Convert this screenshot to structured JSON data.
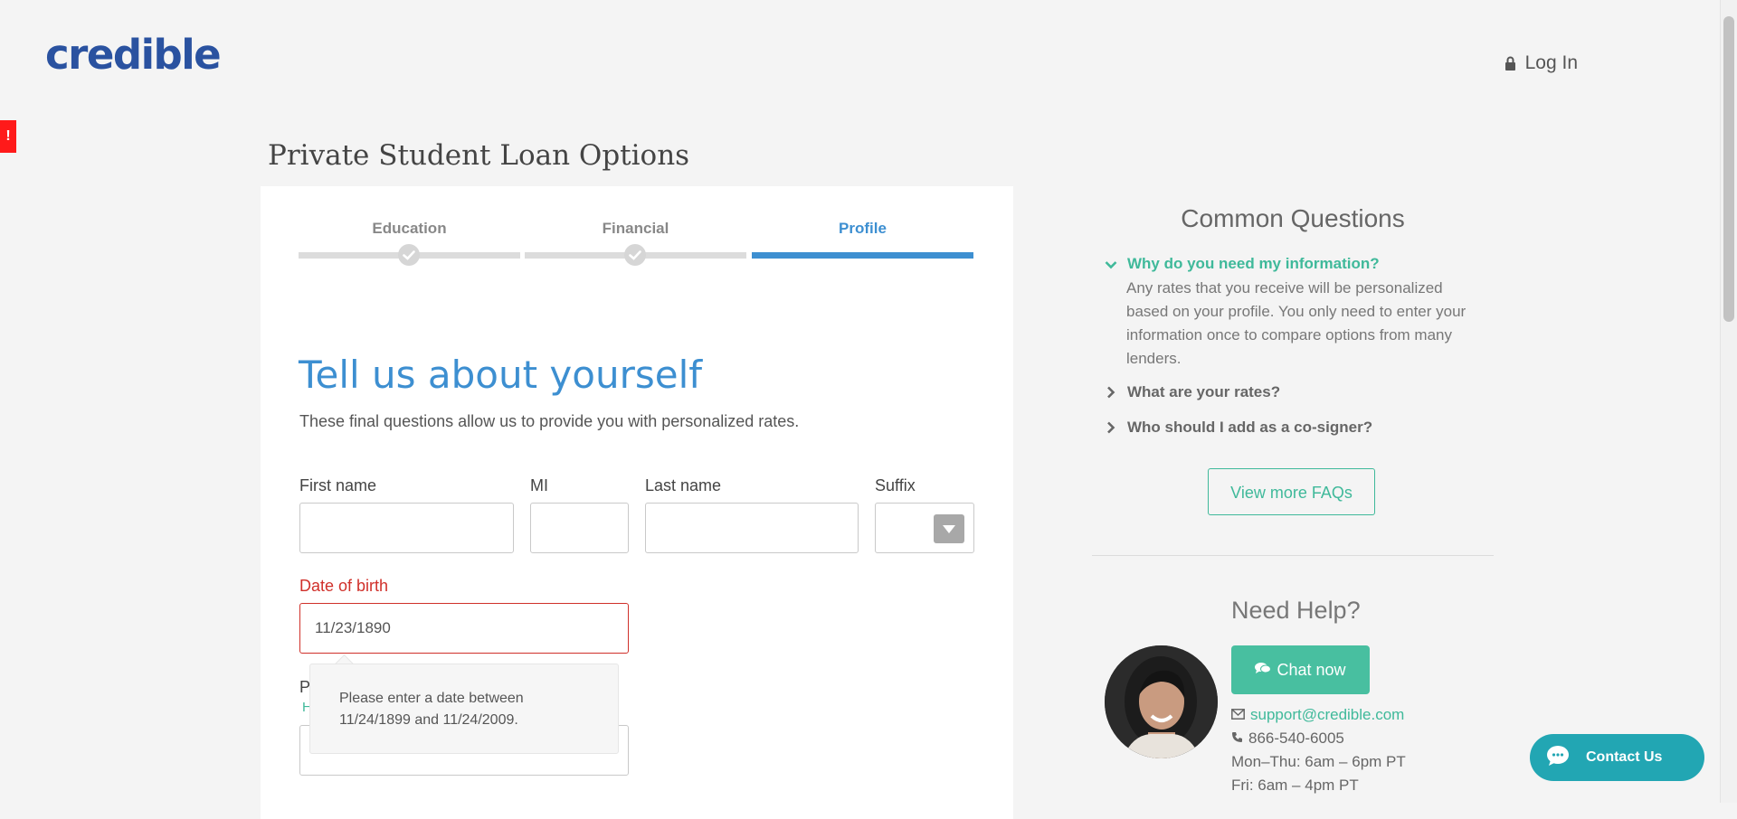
{
  "header": {
    "logo_text": "credible",
    "login_label": "Log In"
  },
  "error_flag": "!",
  "page_title": "Private Student Loan Options",
  "steps": [
    {
      "label": "Education",
      "state": "complete"
    },
    {
      "label": "Financial",
      "state": "complete"
    },
    {
      "label": "Profile",
      "state": "active"
    }
  ],
  "form": {
    "heading": "Tell us about yourself",
    "subheading": "These final questions allow us to provide you with personalized rates.",
    "first_name": {
      "label": "First name",
      "value": ""
    },
    "mi": {
      "label": "MI",
      "value": ""
    },
    "last_name": {
      "label": "Last name",
      "value": ""
    },
    "suffix": {
      "label": "Suffix",
      "value": ""
    },
    "dob": {
      "label": "Date of birth",
      "value": "11/23/1890"
    },
    "partial_label": "P",
    "partial_link": "H",
    "tooltip": "Please enter a date between 11/24/1899 and 11/24/2009."
  },
  "faq": {
    "title": "Common Questions",
    "items": [
      {
        "question": "Why do you need my information?",
        "open": true,
        "answer": "Any rates that you receive will be personalized based on your profile. You only need to enter your information once to compare options from many lenders."
      },
      {
        "question": "What are your rates?",
        "open": false
      },
      {
        "question": "Who should I add as a co-signer?",
        "open": false
      }
    ],
    "more_button": "View more FAQs"
  },
  "help": {
    "title": "Need Help?",
    "chat_button": "Chat now",
    "email": "support@credible.com",
    "phone": "866-540-6005",
    "hours_weekday": "Mon–Thu: 6am – 6pm PT",
    "hours_friday": "Fri: 6am – 4pm PT"
  },
  "contact_us": "Contact Us",
  "colors": {
    "brand_blue": "#2a52a0",
    "step_blue": "#3d8fd1",
    "accent_green": "#3fb99a",
    "error_red": "#d0302a",
    "contact_teal": "#22a6b3"
  }
}
